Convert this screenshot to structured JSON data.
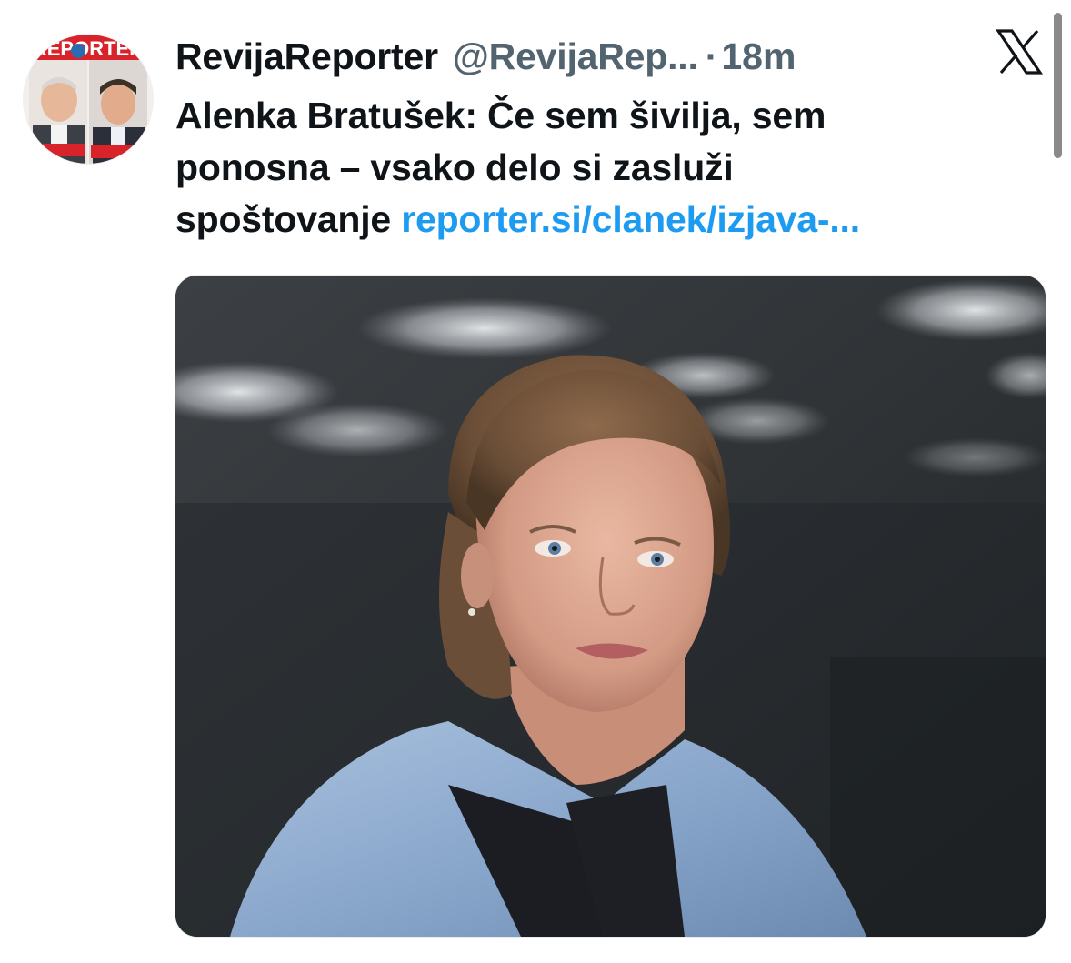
{
  "tweet": {
    "author": {
      "display_name": "RevijaReporter",
      "handle": "@RevijaRep...",
      "avatar_icon": "magazine-cover-avatar",
      "avatar_logo_text": "REPORTER"
    },
    "separator": "·",
    "time": "18m",
    "platform_icon": "x-logo-icon",
    "text": {
      "line1": "Alenka Bratušek: Če sem šivilja, sem",
      "line2": "ponosna – vsako delo si zasluži",
      "line3_prefix": "spoštovanje ",
      "link": "reporter.si/clanek/izjava-..."
    },
    "media": {
      "type": "photo",
      "icon": "portrait-photo"
    }
  },
  "colors": {
    "text": "#0f1419",
    "muted": "#536471",
    "link": "#1d9bf0",
    "background": "#ffffff"
  }
}
